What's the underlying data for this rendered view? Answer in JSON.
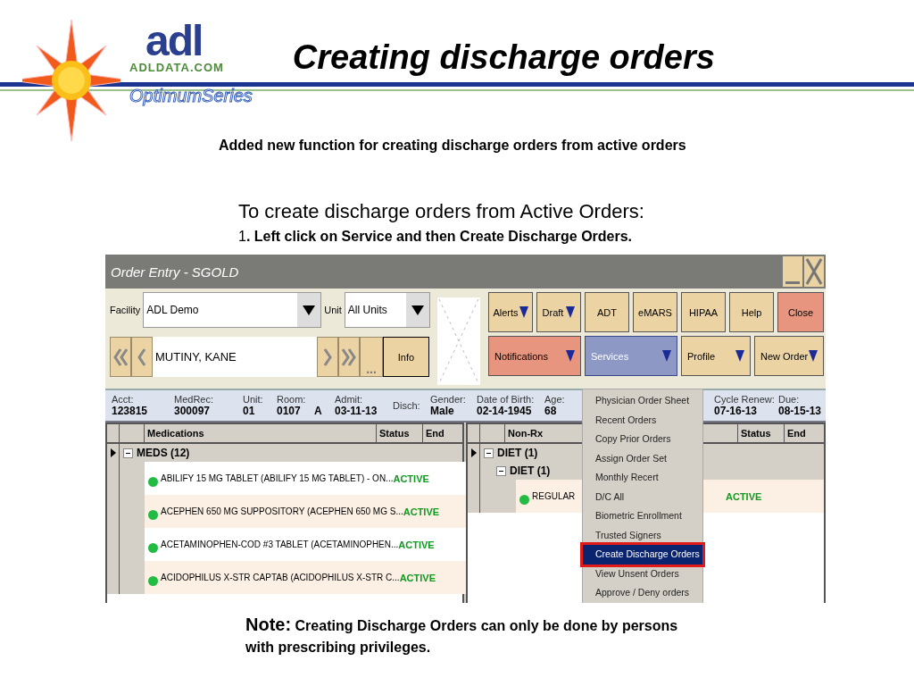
{
  "logo": {
    "brand": "adl",
    "domain": "ADLDATA.COM",
    "series": "OptimumSeries"
  },
  "slide": {
    "title": "Creating discharge orders",
    "subtitle": "Added new function for creating discharge orders from active orders",
    "intro": "To create discharge orders from Active Orders:",
    "step": "1**. Left click on Service and then Create Discharge Orders.**",
    "note": {
      "label": "Note:",
      "text": "Creating Discharge Orders can only be done by persons with prescribing privileges."
    }
  },
  "app": {
    "title": "Order Entry - SGOLD",
    "facility": {
      "label": "Facility",
      "value": "ADL Demo"
    },
    "unit": {
      "label": "Unit",
      "value": "All Units"
    },
    "patient": "MUTINY, KANE",
    "more": "...",
    "info_button": "Info",
    "buttons_row_1": [
      {
        "label": "Alerts",
        "kind": "dropdown",
        "color": "#ecd3a3"
      },
      {
        "label": "Draft",
        "kind": "dropdown",
        "color": "#ecd3a3"
      },
      {
        "label": "ADT",
        "kind": "plain",
        "color": "#ecd3a3"
      },
      {
        "label": "eMARS",
        "kind": "plain",
        "color": "#ecd3a3"
      },
      {
        "label": "HIPAA",
        "kind": "plain",
        "color": "#ecd3a3"
      },
      {
        "label": "Help",
        "kind": "plain",
        "color": "#ecd3a3"
      },
      {
        "label": "Close",
        "kind": "plain",
        "color": "#e8957f"
      }
    ],
    "buttons_row_2": [
      {
        "label": "Notifications",
        "color": "#e8957f",
        "selected": false
      },
      {
        "label": "Services",
        "color": "#8e98c4",
        "selected": true
      },
      {
        "label": "Profile",
        "color": "#ecd3a3",
        "selected": false
      },
      {
        "label": "New Order",
        "color": "#ecd3a3",
        "selected": false
      }
    ],
    "info_fields": [
      {
        "label": "Acct:",
        "value": "123815"
      },
      {
        "label": "MedRec:",
        "value": "300097"
      },
      {
        "label": "Unit:",
        "value": "01"
      },
      {
        "label": "Room:",
        "value": "0107"
      },
      {
        "value": "A"
      },
      {
        "label": "Admit:",
        "value": "03-11-13"
      },
      {
        "label": "Disch:"
      },
      {
        "label": "Gender:",
        "value": "Male"
      },
      {
        "label": "Date of Birth:",
        "value": "02-14-1945"
      },
      {
        "label": "Age:",
        "value": "68"
      },
      {
        "label": "Cycle Renew:",
        "value": "07-16-13"
      },
      {
        "label": "Due:",
        "value": "08-15-13"
      }
    ],
    "medications": {
      "columns": [
        "Medications",
        "Status",
        "End"
      ],
      "group": {
        "label": "MEDS (12)",
        "expanded": true
      },
      "rows": [
        {
          "name": "ABILIFY 15 MG TABLET (ABILIFY 15 MG TABLET) - ON...",
          "status": "ACTIVE",
          "color": "#22bb44"
        },
        {
          "name": "ACEPHEN 650 MG SUPPOSITORY (ACEPHEN 650 MG S...",
          "status": "ACTIVE",
          "color": "#22bb44"
        },
        {
          "name": "ACETAMINOPHEN-COD #3 TABLET (ACETAMINOPHEN...",
          "status": "ACTIVE",
          "color": "#22bb44"
        },
        {
          "name": "ACIDOPHILUS X-STR CAPTAB (ACIDOPHILUS X-STR C...",
          "status": "ACTIVE",
          "color": "#22bb44"
        }
      ]
    },
    "non_rx": {
      "columns": [
        "Non-Rx",
        "Status",
        "End"
      ],
      "group": {
        "label": "DIET (1)",
        "expanded": true,
        "children": [
          {
            "label": "DIET (1)",
            "expanded": true,
            "rows": [
              {
                "name": "REGULAR",
                "status": "ACTIVE",
                "color": "#22bb44"
              }
            ]
          }
        ]
      }
    },
    "services_menu": [
      {
        "label": "Physician Order Sheet",
        "selected": false,
        "highlighted": false
      },
      {
        "label": "Recent Orders",
        "selected": false,
        "highlighted": false
      },
      {
        "label": "Copy Prior Orders",
        "selected": false,
        "highlighted": false
      },
      {
        "label": "Assign Order Set",
        "selected": false,
        "highlighted": false
      },
      {
        "label": "Monthly Recert",
        "selected": false,
        "highlighted": false
      },
      {
        "label": "D/C All",
        "selected": false,
        "highlighted": false
      },
      {
        "label": "Biometric Enrollment",
        "selected": false,
        "highlighted": false
      },
      {
        "label": "Trusted Signers",
        "selected": false,
        "highlighted": false
      },
      {
        "label": "Create Discharge Orders",
        "selected": true,
        "highlighted": true
      },
      {
        "label": "View Unsent Orders",
        "selected": false,
        "highlighted": false
      },
      {
        "label": "Approve / Deny orders",
        "selected": false,
        "highlighted": false
      }
    ]
  }
}
